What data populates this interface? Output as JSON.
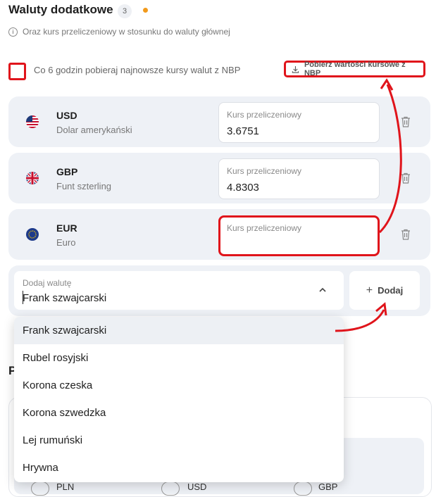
{
  "section": {
    "title": "Waluty dodatkowe",
    "count": "3",
    "subtitle": "Oraz kurs przeliczeniowy w stosunku do waluty głównej"
  },
  "auto_fetch": {
    "label": "Co 6 godzin pobieraj najnowsze kursy walut z NBP",
    "checked": false,
    "fetch_button": "Pobierz wartości kursowe z NBP"
  },
  "currencies": [
    {
      "code": "USD",
      "name": "Dolar amerykański",
      "rate_label": "Kurs przeliczeniowy",
      "rate": "3.6751",
      "flag": "us-flag-icon"
    },
    {
      "code": "GBP",
      "name": "Funt szterling",
      "rate_label": "Kurs przeliczeniowy",
      "rate": "4.8303",
      "flag": "uk-flag-icon"
    },
    {
      "code": "EUR",
      "name": "Euro",
      "rate_label": "Kurs przeliczeniowy",
      "rate": "",
      "flag": "eu-flag-icon"
    }
  ],
  "add_currency": {
    "label": "Dodaj walutę",
    "value": "Frank szwajcarski",
    "button": "Dodaj",
    "options": [
      "Frank szwajcarski",
      "Rubel rosyjski",
      "Korona czeska",
      "Korona szwedzka",
      "Lej rumuński",
      "Hrywna"
    ]
  },
  "background": {
    "heading_letter": "P",
    "table_cols": [
      "PLN",
      "USD",
      "GBP"
    ]
  },
  "colors": {
    "highlight": "#e0141b",
    "dot": "#f29a1b",
    "card": "#eef1f6"
  }
}
